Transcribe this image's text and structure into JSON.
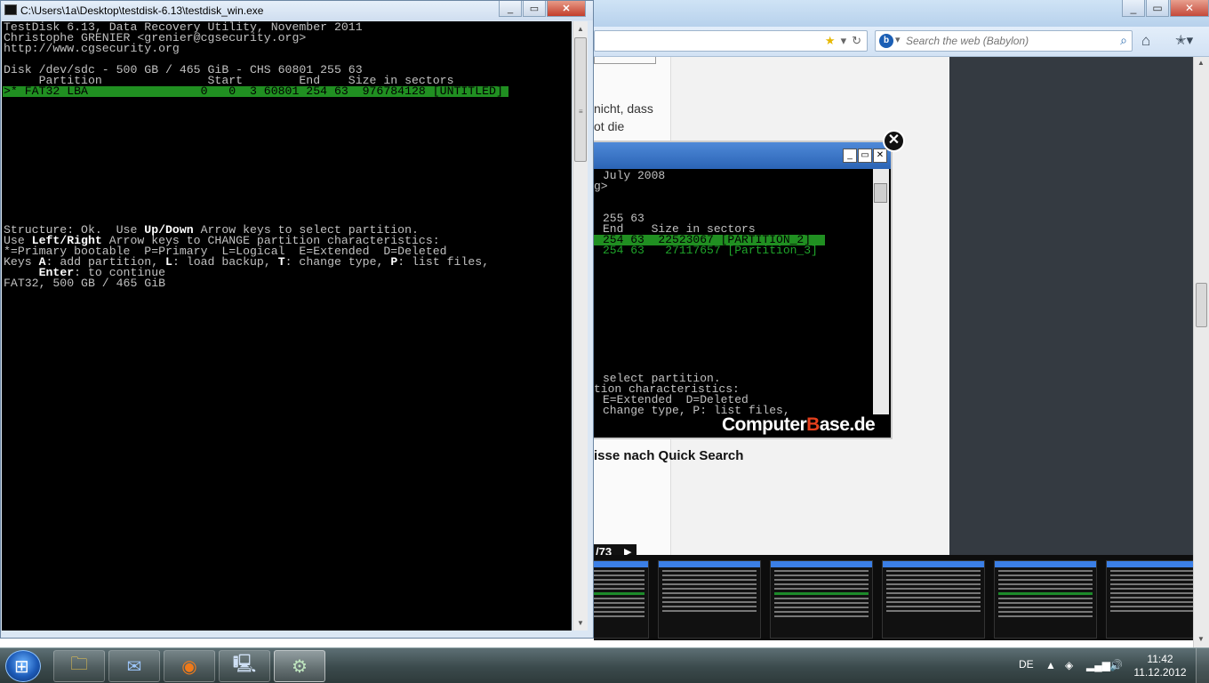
{
  "firefox": {
    "search_placeholder": "Search the web (Babylon)",
    "page_fragments": [
      "nicht, dass",
      "ot die"
    ],
    "overlay_heading": "isse nach Quick Search",
    "gallery_counter": "/73",
    "gallery_next_icon": "triangle-right-icon",
    "thumbnail_count": 6
  },
  "gallery_image": {
    "lines_top": [
      "July 2008",
      "g>",
      "",
      "",
      "255 63",
      "End    Size in sectors"
    ],
    "green_rows": [
      "254 63  22523067 [PARTITION_2]",
      "254 63   27117657 [Partition_3]"
    ],
    "lines_bottom": [
      "select partition.",
      "tion characteristics:",
      "E=Extended  D=Deleted",
      "change type, P: list files,"
    ],
    "logo": {
      "prefix": "Computer",
      "highlight": "B",
      "suffix": "ase.de",
      "highlight_color": "#e6401d"
    }
  },
  "testdisk": {
    "window_title": "C:\\Users\\1a\\Desktop\\testdisk-6.13\\testdisk_win.exe",
    "line1": "TestDisk 6.13, Data Recovery Utility, November 2011",
    "line2": "Christophe GRENIER <grenier@cgsecurity.org>",
    "line3": "http://www.cgsecurity.org",
    "disk": "Disk /dev/sdc - 500 GB / 465 GiB - CHS 60801 255 63",
    "header": "     Partition               Start        End    Size in sectors",
    "selected_row": ">* FAT32 LBA                0   0  3 60801 254 63  976784128 [UNTITLED]",
    "help1_a": "Structure: Ok.  Use ",
    "help1_b": "Up/Down",
    "help1_c": " Arrow keys to select partition.",
    "help2_a": "Use ",
    "help2_b": "Left/Right",
    "help2_c": " Arrow keys to CHANGE partition characteristics:",
    "help3": "*=Primary bootable  P=Primary  L=Logical  E=Extended  D=Deleted",
    "help4_a": "Keys ",
    "help4_b": "A",
    "help4_c": ": add partition, ",
    "help4_d": "L",
    "help4_e": ": load backup, ",
    "help4_f": "T",
    "help4_g": ": change type, ",
    "help4_h": "P",
    "help4_i": ": list files,",
    "help5_a": "     ",
    "help5_b": "Enter",
    "help5_c": ": to continue",
    "summary": "FAT32, 500 GB / 465 GiB",
    "selected_color": "#208f21"
  },
  "taskbar": {
    "apps": [
      "explorer-icon",
      "thunderbird-icon",
      "firefox-icon",
      "network-app-icon",
      "testdisk-icon"
    ],
    "language": "DE",
    "time": "11:42",
    "date": "11.12.2012"
  }
}
